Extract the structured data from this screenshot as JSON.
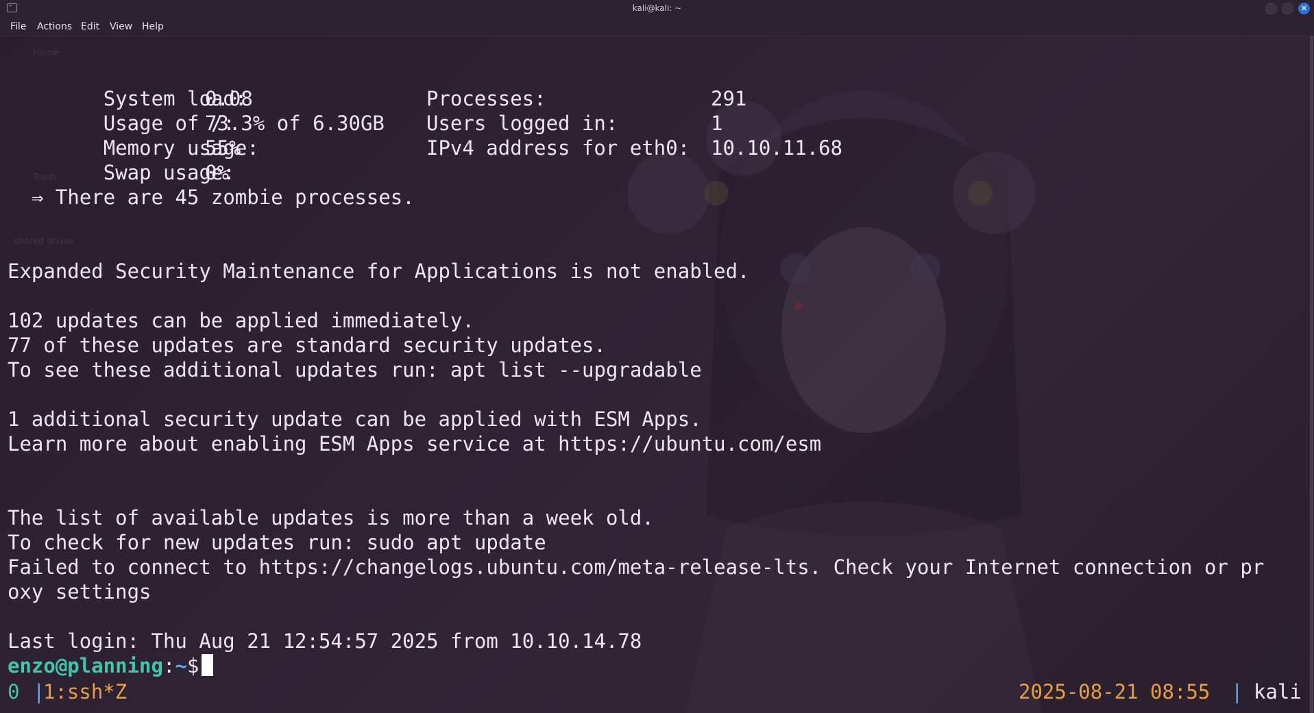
{
  "window": {
    "title": "kali@kali: ~"
  },
  "menu": {
    "file": "File",
    "actions": "Actions",
    "edit": "Edit",
    "view": "View",
    "help": "Help"
  },
  "sysinfo": {
    "system_load_label": "System load:",
    "system_load_value": "0.08",
    "processes_label": "Processes:",
    "processes_value": "291",
    "usage_label": "Usage of /:",
    "usage_value": "73.3% of 6.30GB",
    "users_label": "Users logged in:",
    "users_value": "1",
    "memory_label": "Memory usage:",
    "memory_value": "55%",
    "ipv4_label": "IPv4 address for eth0:",
    "ipv4_value": "10.10.11.68",
    "swap_label": "Swap usage:",
    "swap_value": "0%"
  },
  "terminal": {
    "zombie": "⇒ There are 45 zombie processes.",
    "esm_not_enabled": "Expanded Security Maintenance for Applications is not enabled.",
    "updates_1": "102 updates can be applied immediately.",
    "updates_2": "77 of these updates are standard security updates.",
    "updates_3": "To see these additional updates run: apt list --upgradable",
    "esm_1": "1 additional security update can be applied with ESM Apps.",
    "esm_2": "Learn more about enabling ESM Apps service at https://ubuntu.com/esm",
    "old_1": "The list of available updates is more than a week old.",
    "old_2": "To check for new updates run: sudo apt update",
    "failed_1": "Failed to connect to https://changelogs.ubuntu.com/meta-release-lts. Check your Internet connection or pr",
    "failed_2": "oxy settings",
    "last_login": "Last login: Thu Aug 21 12:54:57 2025 from 10.10.14.78"
  },
  "prompt": {
    "user_host": "enzo@planning",
    "colon": ":",
    "path": "~",
    "symbol": "$"
  },
  "status": {
    "session": "0",
    "sep": "|",
    "window": "1:ssh*Z",
    "datetime": "2025-08-21 08:55",
    "host": "kali"
  },
  "colors": {
    "background": "#2b1f2f",
    "text": "#ece7ee",
    "prompt_user": "#3fc7a8",
    "prompt_path": "#5aa8ef",
    "status_orange": "#e6a040",
    "close_button": "#2b74d6"
  }
}
